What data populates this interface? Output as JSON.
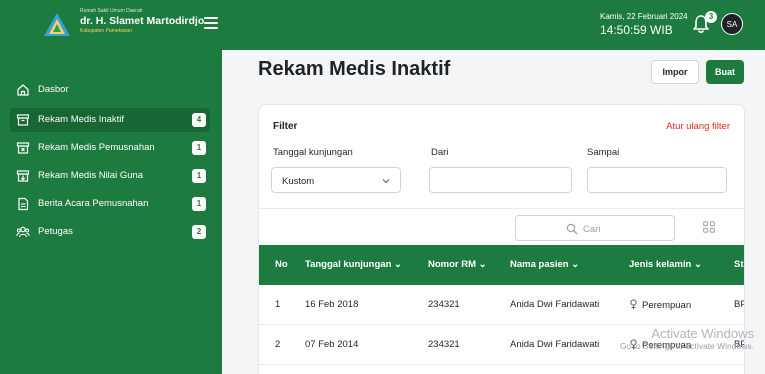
{
  "header": {
    "brand_small": "Rumah Sakit Umum Daerah",
    "brand_name": "dr. H. Slamet Martodirdjo",
    "brand_sub": "Kabupaten Pamekasan",
    "date": "Kamis, 22 Februari 2024",
    "time": "14:50:59 WIB",
    "notification_count": "3",
    "avatar_initials": "SA"
  },
  "sidebar": {
    "items": [
      {
        "label": "Dasbor",
        "icon": "home-icon"
      },
      {
        "label": "Rekam Medis Inaktif",
        "badge": "4",
        "icon": "archive-icon",
        "active": true
      },
      {
        "label": "Rekam Medis Pemusnahan",
        "badge": "1",
        "icon": "archive-x-icon"
      },
      {
        "label": "Rekam Medis Nilai Guna",
        "badge": "1",
        "icon": "archive-down-icon"
      },
      {
        "label": "Berita Acara Pemusnahan",
        "badge": "1",
        "icon": "document-icon"
      },
      {
        "label": "Petugas",
        "badge": "2",
        "icon": "users-icon"
      }
    ]
  },
  "main": {
    "title": "Rekam Medis Inaktif",
    "import_label": "Impor",
    "create_label": "Buat"
  },
  "filter": {
    "title": "Filter",
    "reset_label": "Atur ulang filter",
    "visit_date_label": "Tanggal kunjungan",
    "visit_date_value": "Kustom",
    "from_label": "Dari",
    "to_label": "Sampai"
  },
  "search": {
    "placeholder": "Cari"
  },
  "table": {
    "columns": [
      "No",
      "Tanggal kunjungan",
      "Nomor RM",
      "Nama pasien",
      "Jenis kelamin",
      "Statu"
    ],
    "rows": [
      {
        "no": "1",
        "date": "16 Feb 2018",
        "rm": "234321",
        "name": "Anida Dwi Faridawati",
        "gender": "Perempuan",
        "status": "BPJS"
      },
      {
        "no": "2",
        "date": "07 Feb 2014",
        "rm": "234321",
        "name": "Anida Dwi Faridawati",
        "gender": "Perempuan",
        "status": "BPJS"
      }
    ]
  },
  "watermark": {
    "title": "Activate Windows",
    "subtitle": "Go to Settings to activate Windows."
  },
  "colors": {
    "primary": "#1e7b3f",
    "danger": "#d92d20"
  }
}
